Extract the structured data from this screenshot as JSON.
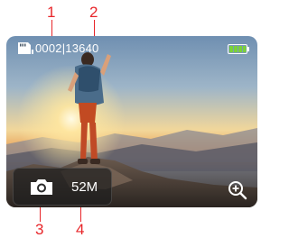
{
  "callouts": {
    "c1": "1",
    "c2": "2",
    "c3": "3",
    "c4": "4"
  },
  "hud": {
    "photo_counter": "0002|13640",
    "resolution": "52M",
    "battery_level": 1.0,
    "battery_color": "#7bd13a",
    "icons": {
      "storage": "sd-card-icon",
      "mode": "camera-icon",
      "zoom": "zoom-in-icon",
      "battery": "battery-icon"
    }
  },
  "viewfinder": {
    "subject": "hiker on rocky summit at sunrise"
  }
}
